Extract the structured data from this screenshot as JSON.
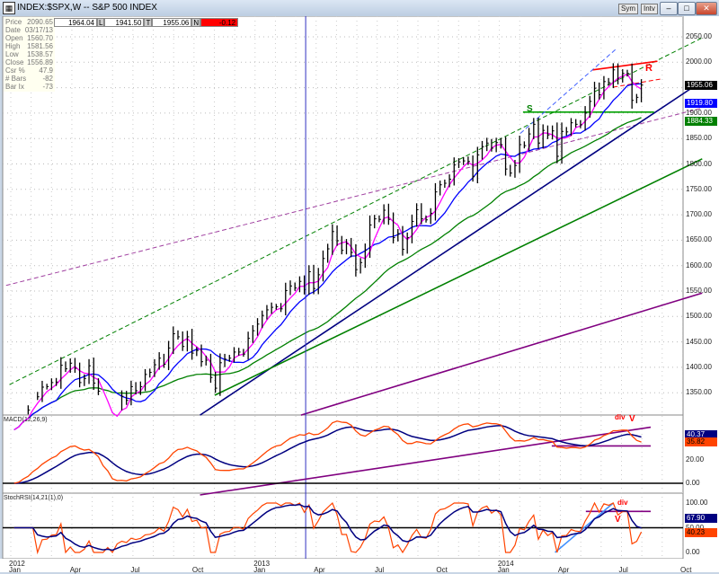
{
  "window": {
    "title": "INDEX:$SPX,W -- S&P 500 INDEX",
    "sym_button": "Sym",
    "intv_button": "Intv",
    "min": "–",
    "max": "□",
    "close": "✕"
  },
  "info": [
    {
      "k": "Price",
      "v": "2090.65"
    },
    {
      "k": "Date",
      "v": "03/17/13"
    },
    {
      "k": "Open",
      "v": "1560.70"
    },
    {
      "k": "High",
      "v": "1581.56"
    },
    {
      "k": "Low",
      "v": "1538.57"
    },
    {
      "k": "Close",
      "v": "1556.89"
    },
    {
      "k": "Csr %",
      "v": "47.9"
    },
    {
      "k": "# Bars",
      "v": "-82"
    },
    {
      "k": "Bar Ix",
      "v": "-73"
    }
  ],
  "quote": {
    "h": "1964.04",
    "l_label": "L",
    "l": "1941.50",
    "t_label": "T",
    "t": "1955.06",
    "n_label": "N",
    "n": "-0.12"
  },
  "colors": {
    "bars": "#000000",
    "ma_fast": "#ff00ff",
    "ma_mid": "#0000ff",
    "ma_slow": "#008000",
    "macd": "#ff4400",
    "signal": "#000080",
    "trend_navy": "#000080",
    "trend_purple": "#800080",
    "resistance": "#ff0000",
    "down_badge": "#ff0000"
  },
  "chart_data": [
    {
      "type": "ohlc",
      "title": "INDEX:$SPX,W -- S&P 500 INDEX",
      "frequency": "weekly",
      "first_week": "2012-01-06",
      "closes": [
        1277,
        1289,
        1315,
        1316,
        1344,
        1342,
        1361,
        1362,
        1370,
        1371,
        1404,
        1397,
        1408,
        1398,
        1370,
        1378,
        1403,
        1369,
        1353,
        1295,
        1317,
        1278,
        1325,
        1343,
        1335,
        1362,
        1354,
        1362,
        1386,
        1390,
        1405,
        1418,
        1406,
        1438,
        1466,
        1460,
        1441,
        1460,
        1428,
        1433,
        1411,
        1414,
        1380,
        1359,
        1409,
        1416,
        1418,
        1430,
        1430,
        1426,
        1457,
        1472,
        1485,
        1502,
        1513,
        1518,
        1519,
        1515,
        1551,
        1560,
        1556,
        1569,
        1553,
        1588,
        1555,
        1582,
        1614,
        1633,
        1667,
        1649,
        1630,
        1643,
        1626,
        1592,
        1606,
        1631,
        1680,
        1692,
        1691,
        1709,
        1691,
        1655,
        1663,
        1632,
        1655,
        1687,
        1710,
        1692,
        1690,
        1703,
        1745,
        1759,
        1762,
        1770,
        1798,
        1804,
        1806,
        1805,
        1775,
        1818,
        1834,
        1841,
        1831,
        1842,
        1838,
        1790,
        1782,
        1797,
        1838,
        1836,
        1859,
        1878,
        1841,
        1866,
        1857,
        1865,
        1815,
        1864,
        1863,
        1881,
        1878,
        1877,
        1900,
        1923,
        1949,
        1936,
        1962,
        1960,
        1985,
        1967,
        1978,
        1978,
        1925,
        1931,
        1955.06
      ],
      "ylim": [
        1306,
        2090.65
      ],
      "y_ticks": [
        "2050.00",
        "2000.00",
        "1950.00",
        "1900.00",
        "1850.00",
        "1800.00",
        "1750.00",
        "1700.00",
        "1650.00",
        "1600.00",
        "1550.00",
        "1500.00",
        "1450.00",
        "1400.00",
        "1350.00"
      ],
      "moving_averages": [
        {
          "period": 4,
          "color": "#ff00ff"
        },
        {
          "period": 10,
          "color": "#0000ff"
        },
        {
          "period": 30,
          "color": "#008000"
        }
      ],
      "last_value_labels": [
        {
          "text": "1955.06",
          "bg": "#000000",
          "fg": "#ffffff",
          "value": 1955.06
        },
        {
          "text": "1919.80",
          "bg": "#0000ff",
          "fg": "#ffffff",
          "value": 1919.8
        },
        {
          "text": "1884.33",
          "bg": "#008000",
          "fg": "#ffffff",
          "value": 1884.33
        }
      ],
      "cursor_date": "2013-03-17",
      "trendlines": [
        {
          "from": [
            "2011-12-30",
            1366
          ],
          "to": [
            "2014-10-31",
            2048
          ],
          "color": "#008000",
          "dash": true
        },
        {
          "from": [
            "2011-12-25",
            1561
          ],
          "to": [
            "2014-10-31",
            1910
          ],
          "color": "#a040a0",
          "dash": true
        },
        {
          "from": [
            "2012-10-10",
            1306
          ],
          "to": [
            "2014-10-31",
            1963
          ],
          "color": "#000080",
          "dash": false
        },
        {
          "from": [
            "2012-11-01",
            1345
          ],
          "to": [
            "2014-10-31",
            1810
          ],
          "color": "#008000",
          "dash": false
        },
        {
          "from": [
            "2013-03-10",
            1306
          ],
          "to": [
            "2014-10-31",
            1546
          ],
          "color": "#800080",
          "dash": false
        },
        {
          "from": [
            "2014-05-20",
            1985
          ],
          "to": [
            "2014-08-25",
            2002
          ],
          "color": "#ff0000",
          "dash": false
        },
        {
          "from": [
            "2014-06-20",
            1951
          ],
          "to": [
            "2014-08-30",
            1967
          ],
          "color": "#ff0000",
          "dash": true
        },
        {
          "from": [
            "2014-02-05",
            1902
          ],
          "to": [
            "2014-08-20",
            1902
          ],
          "color": "#00a000",
          "dash": false
        },
        {
          "from": [
            "2014-02-01",
            1860
          ],
          "to": [
            "2014-06-25",
            2027
          ],
          "color": "#4060ff",
          "dash": true
        }
      ],
      "annotations": [
        {
          "text": "S",
          "color": "#008000"
        },
        {
          "text": "R",
          "color": "#ff0000"
        }
      ]
    },
    {
      "type": "line",
      "title": "MACD(12,26,9)",
      "ylim": [
        -10,
        58
      ],
      "y_ticks": [
        "20.00",
        "0.00"
      ],
      "last_value_labels": [
        {
          "text": "40.37",
          "bg": "#000080",
          "fg": "#ffffff"
        },
        {
          "text": "35.82",
          "bg": "#ff4400",
          "fg": "#000000"
        }
      ],
      "trendlines": [
        {
          "from": [
            "2012-10-10",
            -10
          ],
          "to": [
            "2014-08-15",
            48
          ],
          "color": "#800080"
        },
        {
          "from": [
            "2014-03-20",
            32
          ],
          "to": [
            "2014-08-15",
            32
          ],
          "color": "#800080"
        }
      ],
      "annotations": [
        {
          "text": "div",
          "color": "#ff0000"
        },
        {
          "text": "V",
          "color": "#ff0000"
        }
      ]
    },
    {
      "type": "line",
      "title": "StochRSI(14,21(1),0)",
      "ylim": [
        -12,
        115
      ],
      "y_ticks": [
        "100.00",
        "50.00",
        "0.00"
      ],
      "last_value_labels": [
        {
          "text": "67.90",
          "bg": "#000080",
          "fg": "#ffffff"
        },
        {
          "text": "40.23",
          "bg": "#ff4400",
          "fg": "#000000"
        }
      ],
      "trendlines": [
        {
          "from": [
            "2014-05-10",
            83
          ],
          "to": [
            "2014-08-15",
            83
          ],
          "color": "#800080"
        },
        {
          "from": [
            "2014-03-25",
            0
          ],
          "to": [
            "2014-06-20",
            100
          ],
          "color": "#4090ff"
        }
      ],
      "annotations": [
        {
          "text": "div",
          "color": "#ff0000"
        },
        {
          "text": "V",
          "color": "#ff0000"
        }
      ]
    }
  ],
  "x_axis": [
    {
      "label": "Jan",
      "year": "2012",
      "date": "2012-01-01"
    },
    {
      "label": "Apr",
      "year": "",
      "date": "2012-04-01"
    },
    {
      "label": "Jul",
      "year": "",
      "date": "2012-07-01"
    },
    {
      "label": "Oct",
      "year": "",
      "date": "2012-10-01"
    },
    {
      "label": "Jan",
      "year": "2013",
      "date": "2013-01-01"
    },
    {
      "label": "Apr",
      "year": "",
      "date": "2013-04-01"
    },
    {
      "label": "Jul",
      "year": "",
      "date": "2013-07-01"
    },
    {
      "label": "Oct",
      "year": "",
      "date": "2013-10-01"
    },
    {
      "label": "Jan",
      "year": "2014",
      "date": "2014-01-01"
    },
    {
      "label": "Apr",
      "year": "",
      "date": "2014-04-01"
    },
    {
      "label": "Jul",
      "year": "",
      "date": "2014-07-01"
    },
    {
      "label": "Oct",
      "year": "",
      "date": "2014-10-01"
    }
  ]
}
